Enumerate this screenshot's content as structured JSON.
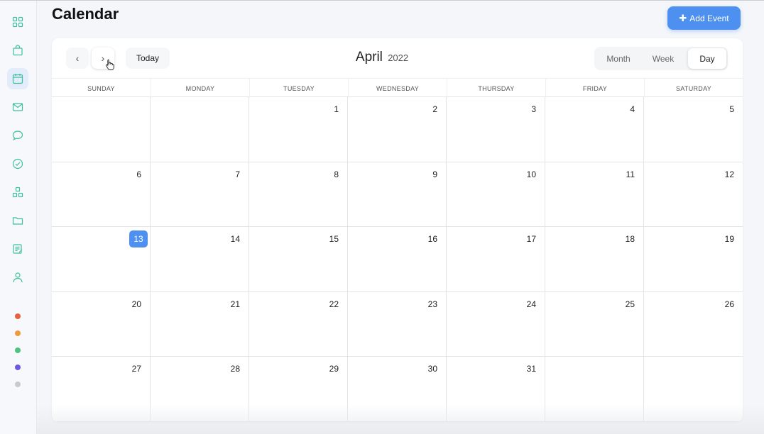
{
  "app": {
    "title": "Calendar"
  },
  "header": {
    "add_event_label": "Add Event",
    "add_event_icon": "plus-icon"
  },
  "toolbar": {
    "prev_label": "‹",
    "next_label": "›",
    "today_label": "Today",
    "month": "April",
    "year": "2022",
    "views": [
      "Month",
      "Week",
      "Day"
    ],
    "active_view": "Day"
  },
  "sidebar": {
    "icons": [
      "dashboard-icon",
      "shopping-bag-icon",
      "calendar-icon",
      "mail-icon",
      "chat-icon",
      "check-circle-icon",
      "apps-icon",
      "folder-icon",
      "notes-icon",
      "user-icon"
    ],
    "active": "calendar-icon",
    "dots": [
      "#e8603c",
      "#ef9a3d",
      "#4cc47f",
      "#6a5ae0",
      "#c8cacf"
    ]
  },
  "calendar": {
    "weekdays": [
      "SUNDAY",
      "MONDAY",
      "TUESDAY",
      "WEDNESDAY",
      "THURSDAY",
      "FRIDAY",
      "SATURDAY"
    ],
    "weeks": [
      [
        "",
        "",
        "1",
        "2",
        "3",
        "4",
        "5"
      ],
      [
        "6",
        "7",
        "8",
        "9",
        "10",
        "11",
        "12"
      ],
      [
        "13",
        "14",
        "15",
        "16",
        "17",
        "18",
        "19"
      ],
      [
        "20",
        "21",
        "22",
        "23",
        "24",
        "25",
        "26"
      ],
      [
        "27",
        "28",
        "29",
        "30",
        "31",
        "",
        ""
      ]
    ],
    "today": "13",
    "accent": "#4d90f0"
  }
}
